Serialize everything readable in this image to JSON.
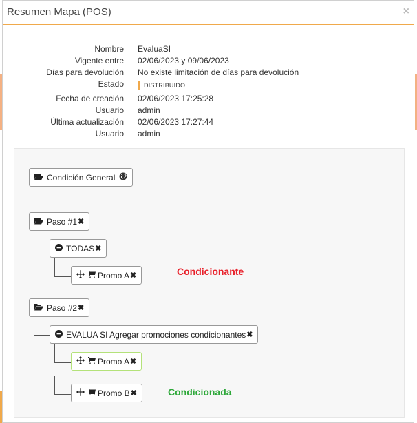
{
  "modal": {
    "title": "Resumen Mapa (POS)",
    "close_icon": "×"
  },
  "summary": [
    {
      "label": "Nombre",
      "value": "EvaluaSI"
    },
    {
      "label": "Vigente entre",
      "value": "02/06/2023 y 09/06/2023"
    },
    {
      "label": "Días para devolución",
      "value": "No existe limitación de días para devolución"
    },
    {
      "label": "Estado",
      "value": "DISTRIBUIDO"
    },
    {
      "label": "Fecha de creación",
      "value": "02/06/2023 17:25:28"
    },
    {
      "label": "Usuario",
      "value": "admin"
    },
    {
      "label": "Última actualización",
      "value": "02/06/2023 17:27:44"
    },
    {
      "label": "Usuario",
      "value": "admin"
    }
  ],
  "colors": {
    "accent": "#f0a94b",
    "condicionante": "#e8212b",
    "condicionada": "#2ea83a",
    "highlight_border": "#b4e27a"
  },
  "tree": {
    "general": {
      "label": "Condición General",
      "icon": "folder-open-icon",
      "extra_icon": "globe-icon"
    },
    "steps": [
      {
        "label": "Paso #1",
        "group": {
          "label": "TODAS"
        },
        "items": [
          {
            "label": "Promo A"
          }
        ]
      },
      {
        "label": "Paso #2",
        "group": {
          "label": "EVALUA SI Agregar promociones condicionantes"
        },
        "items": [
          {
            "label": "Promo A"
          },
          {
            "label": "Promo B"
          }
        ]
      }
    ],
    "annotations": {
      "condicionante": "Condicionante",
      "condicionada": "Condicionada"
    }
  }
}
